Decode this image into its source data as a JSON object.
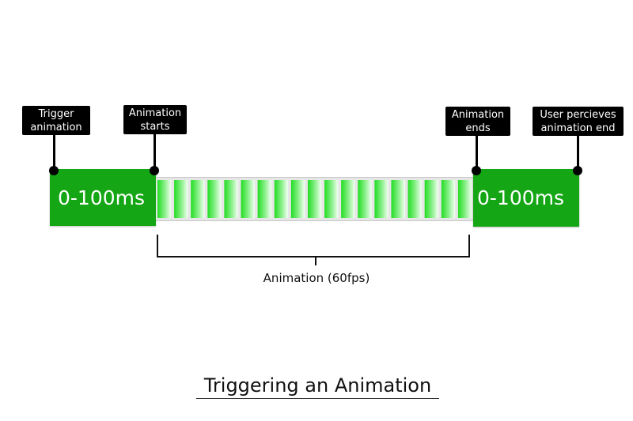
{
  "title": "Triggering an Animation",
  "callouts": {
    "trigger": {
      "line1": "Trigger",
      "line2": "animation"
    },
    "start": {
      "line1": "Animation",
      "line2": "starts"
    },
    "end": {
      "line1": "Animation",
      "line2": "ends"
    },
    "perceive": {
      "line1": "User percieves",
      "line2": "animation end"
    }
  },
  "blocks": {
    "left": "0-100ms",
    "right": "0-100ms"
  },
  "animation": {
    "label": "Animation (60fps)",
    "frame_count": 19
  },
  "colors": {
    "block_green": "#14a614",
    "frame_green": "#22dd22",
    "frame_track": "#e6e6e6",
    "callout_bg": "#000000"
  }
}
